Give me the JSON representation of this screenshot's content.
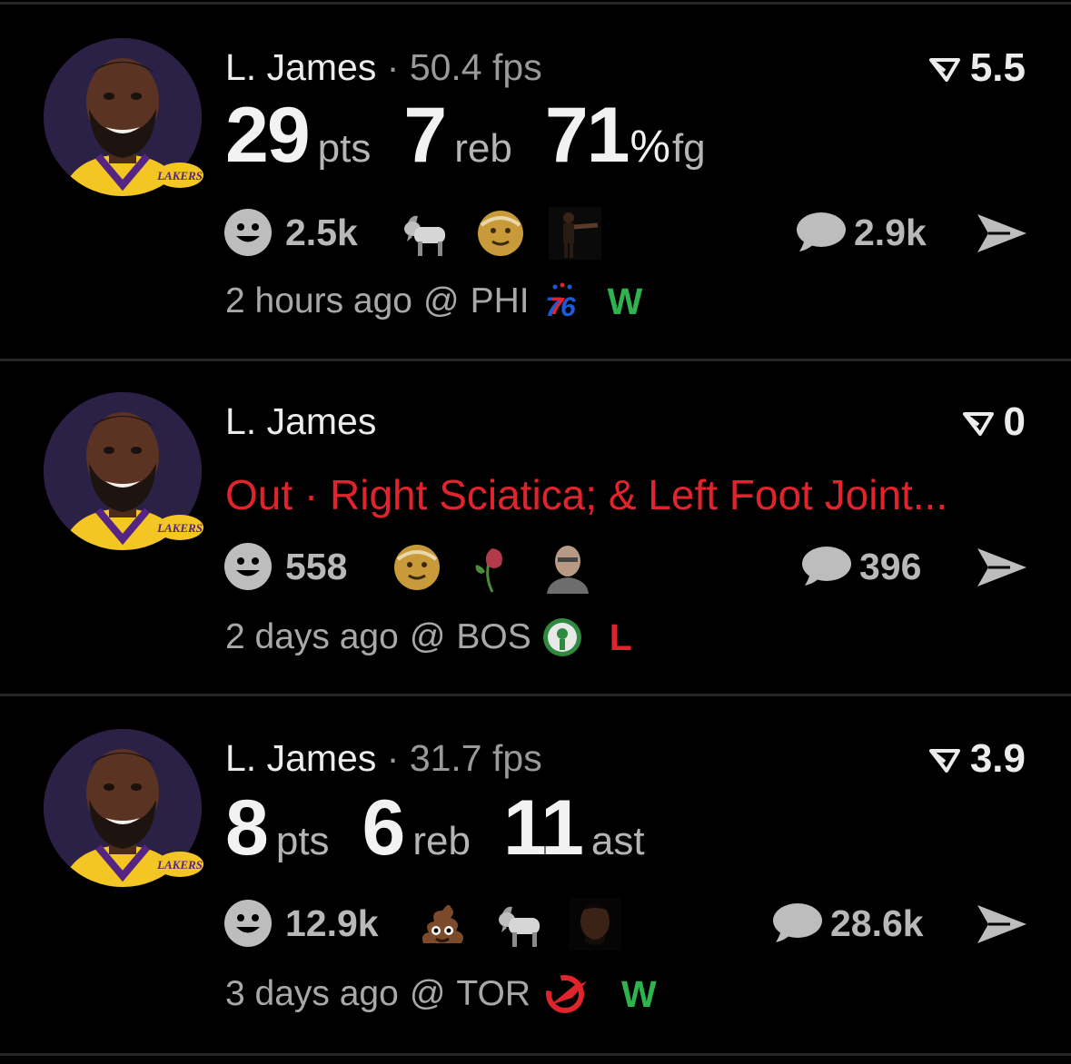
{
  "feed": [
    {
      "player_name": "L. James",
      "separator": "·",
      "fps": "50.4 fps",
      "fantasy_value": "5.5",
      "stats": [
        {
          "value": "29",
          "label": "pts"
        },
        {
          "value": "7",
          "label": "reb"
        },
        {
          "value": "71",
          "pct": "%",
          "label": "fg"
        }
      ],
      "reaction_count": "2.5k",
      "reactions": [
        "goat-emoji",
        "old-man-emoji",
        "player-gif-sticker"
      ],
      "comment_count": "2.9k",
      "time_ago": "2 hours ago",
      "at": "@",
      "opponent": "PHI",
      "opponent_logo": "76",
      "result": "W"
    },
    {
      "player_name": "L. James",
      "fantasy_value": "0",
      "status": "Out · Right Sciatica; & Left Foot Joint...",
      "reaction_count": "558",
      "reactions": [
        "old-man-emoji",
        "wilted-flower-emoji",
        "bald-person-sticker"
      ],
      "comment_count": "396",
      "time_ago": "2 days ago",
      "at": "@",
      "opponent": "BOS",
      "opponent_logo": "celtics",
      "result": "L"
    },
    {
      "player_name": "L. James",
      "separator": "·",
      "fps": "31.7 fps",
      "fantasy_value": "3.9",
      "stats": [
        {
          "value": "8",
          "label": "pts"
        },
        {
          "value": "6",
          "label": "reb"
        },
        {
          "value": "11",
          "label": "ast"
        }
      ],
      "reaction_count": "12.9k",
      "reactions": [
        "poop-emoji",
        "goat-emoji",
        "player-face-sticker"
      ],
      "comment_count": "28.6k",
      "time_ago": "3 days ago",
      "at": "@",
      "opponent": "TOR",
      "opponent_logo": "raptors",
      "result": "W"
    }
  ],
  "team_logo_text": "LAKERS",
  "colors": {
    "background": "#000000",
    "win": "#2fb34f",
    "loss": "#e0242b",
    "muted": "#9a9a9a"
  }
}
